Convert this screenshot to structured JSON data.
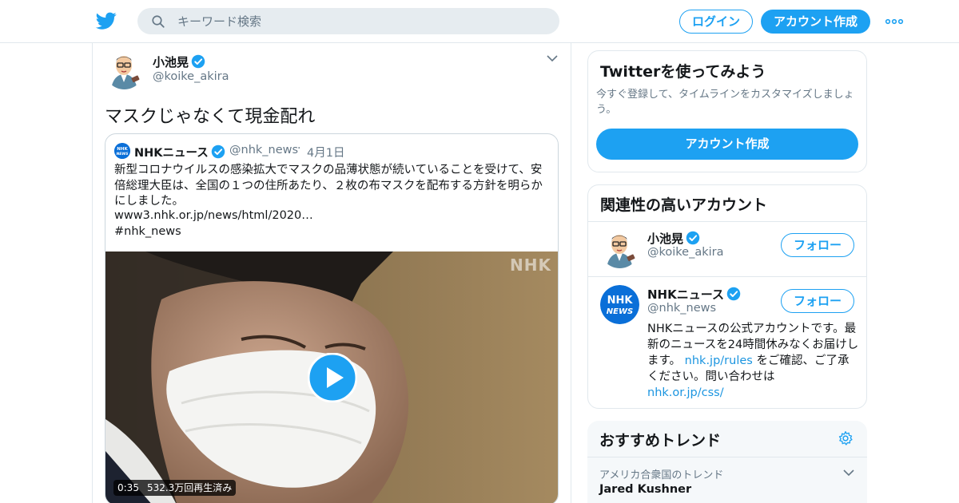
{
  "header": {
    "logo_icon": "twitter-bird-icon",
    "search_placeholder": "キーワード検索",
    "login_label": "ログイン",
    "signup_label": "アカウント作成",
    "more_icon": "more-dots-icon",
    "accent_color": "#1da1f2"
  },
  "tweet": {
    "author_name": "小池晃",
    "author_handle": "@koike_akira",
    "verified_icon": "verified-badge-icon",
    "text": "マスクじゃなくて現金配れ",
    "quote": {
      "name": "NHKニュース",
      "handle": "@nhk_news",
      "separator": "·",
      "date": "4月1日",
      "body": "新型コロナウイルスの感染拡大でマスクの品薄状態が続いていることを受けて、安倍総理大臣は、全国の１つの住所あたり、２枚の布マスクを配布する方針を明らかにしました。",
      "link": "www3.nhk.or.jp/news/html/2020…",
      "hashtag": "#nhk_news",
      "video": {
        "watermark": "NHK",
        "duration": "0:35",
        "views": "532.3万回再生済み",
        "play_icon": "play-button-icon"
      }
    }
  },
  "signup_card": {
    "title": "Twitterを使ってみよう",
    "subtitle": "今すぐ登録して、タイムラインをカスタマイズしましょう。",
    "button": "アカウント作成"
  },
  "related": {
    "title": "関連性の高いアカウント",
    "accounts": [
      {
        "name": "小池晃",
        "handle": "@koike_akira",
        "follow": "フォロー"
      },
      {
        "name": "NHKニュース",
        "handle": "@nhk_news",
        "follow": "フォロー",
        "bio_1": "NHKニュースの公式アカウントです。最新のニュースを24時間休みなくお届けします。",
        "bio_link_1": "nhk.jp/rules",
        "bio_2": "をご確認、ご了承ください。問い合わせは",
        "bio_link_2": "nhk.or.jp/css/"
      }
    ]
  },
  "trends": {
    "title": "おすすめトレンド",
    "settings_icon": "gear-icon",
    "items": [
      {
        "meta": "アメリカ合衆国のトレンド",
        "name": "Jared Kushner"
      }
    ]
  }
}
